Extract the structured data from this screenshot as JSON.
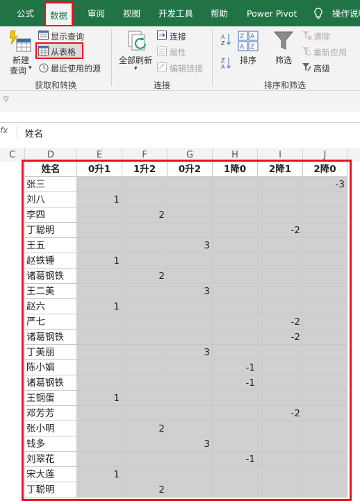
{
  "tabs": [
    {
      "label": "公式",
      "active": false
    },
    {
      "label": "数据",
      "active": true
    },
    {
      "label": "审阅",
      "active": false
    },
    {
      "label": "视图",
      "active": false
    },
    {
      "label": "开发工具",
      "active": false
    },
    {
      "label": "帮助",
      "active": false
    },
    {
      "label": "Power Pivot",
      "active": false
    },
    {
      "label": "操作说明",
      "active": false
    }
  ],
  "ribbon": {
    "get_transform": {
      "new_query_line1": "新建",
      "new_query_line2": "查询",
      "show_queries": "显示查询",
      "from_table": "从表格",
      "recent_sources": "最近使用的源",
      "group_label": "获取和转换"
    },
    "connections": {
      "refresh_all": "全部刷新",
      "connections": "连接",
      "properties": "属性",
      "edit_links": "编辑链接",
      "group_label": "连接"
    },
    "sort_filter": {
      "sort": "排序",
      "filter": "筛选",
      "clear": "清除",
      "reapply": "重新应用",
      "advanced": "高级",
      "group_label": "排序和筛选"
    }
  },
  "formula_bar": {
    "fx_label": "fx",
    "value": "姓名"
  },
  "columns": [
    "C",
    "D",
    "E",
    "F",
    "G",
    "H",
    "I",
    "J"
  ],
  "table": {
    "headers": [
      "姓名",
      "0升1",
      "1升2",
      "0升2",
      "1降0",
      "2降1",
      "2降0"
    ],
    "rows": [
      [
        "张三",
        "",
        "",
        "",
        "",
        "",
        "-3"
      ],
      [
        "刘八",
        "1",
        "",
        "",
        "",
        "",
        ""
      ],
      [
        "李四",
        "",
        "2",
        "",
        "",
        "",
        ""
      ],
      [
        "丁聪明",
        "",
        "",
        "",
        "",
        "-2",
        ""
      ],
      [
        "王五",
        "",
        "",
        "3",
        "",
        "",
        ""
      ],
      [
        "赵铁锤",
        "1",
        "",
        "",
        "",
        "",
        ""
      ],
      [
        "诸葛钢铁",
        "",
        "2",
        "",
        "",
        "",
        ""
      ],
      [
        "王二美",
        "",
        "",
        "3",
        "",
        "",
        ""
      ],
      [
        "赵六",
        "1",
        "",
        "",
        "",
        "",
        ""
      ],
      [
        "严七",
        "",
        "",
        "",
        "",
        "-2",
        ""
      ],
      [
        "诸葛钢铁",
        "",
        "",
        "",
        "",
        "-2",
        ""
      ],
      [
        "丁美丽",
        "",
        "",
        "3",
        "",
        "",
        ""
      ],
      [
        "陈小娟",
        "",
        "",
        "",
        "-1",
        "",
        ""
      ],
      [
        "诸葛钢铁",
        "",
        "",
        "",
        "-1",
        "",
        ""
      ],
      [
        "王钢蛋",
        "1",
        "",
        "",
        "",
        "",
        ""
      ],
      [
        "邓芳芳",
        "",
        "",
        "",
        "",
        "-2",
        ""
      ],
      [
        "张小明",
        "",
        "2",
        "",
        "",
        "",
        ""
      ],
      [
        "钱多",
        "",
        "",
        "3",
        "",
        "",
        ""
      ],
      [
        "刘翠花",
        "",
        "",
        "",
        "-1",
        "",
        ""
      ],
      [
        "宋大莲",
        "1",
        "",
        "",
        "",
        "",
        ""
      ],
      [
        "丁聪明",
        "",
        "2",
        "",
        "",
        "",
        ""
      ]
    ]
  },
  "colors": {
    "ribbon_green": "#217346",
    "highlight_red": "#e81123",
    "cell_fill": "#d0d0d0"
  }
}
